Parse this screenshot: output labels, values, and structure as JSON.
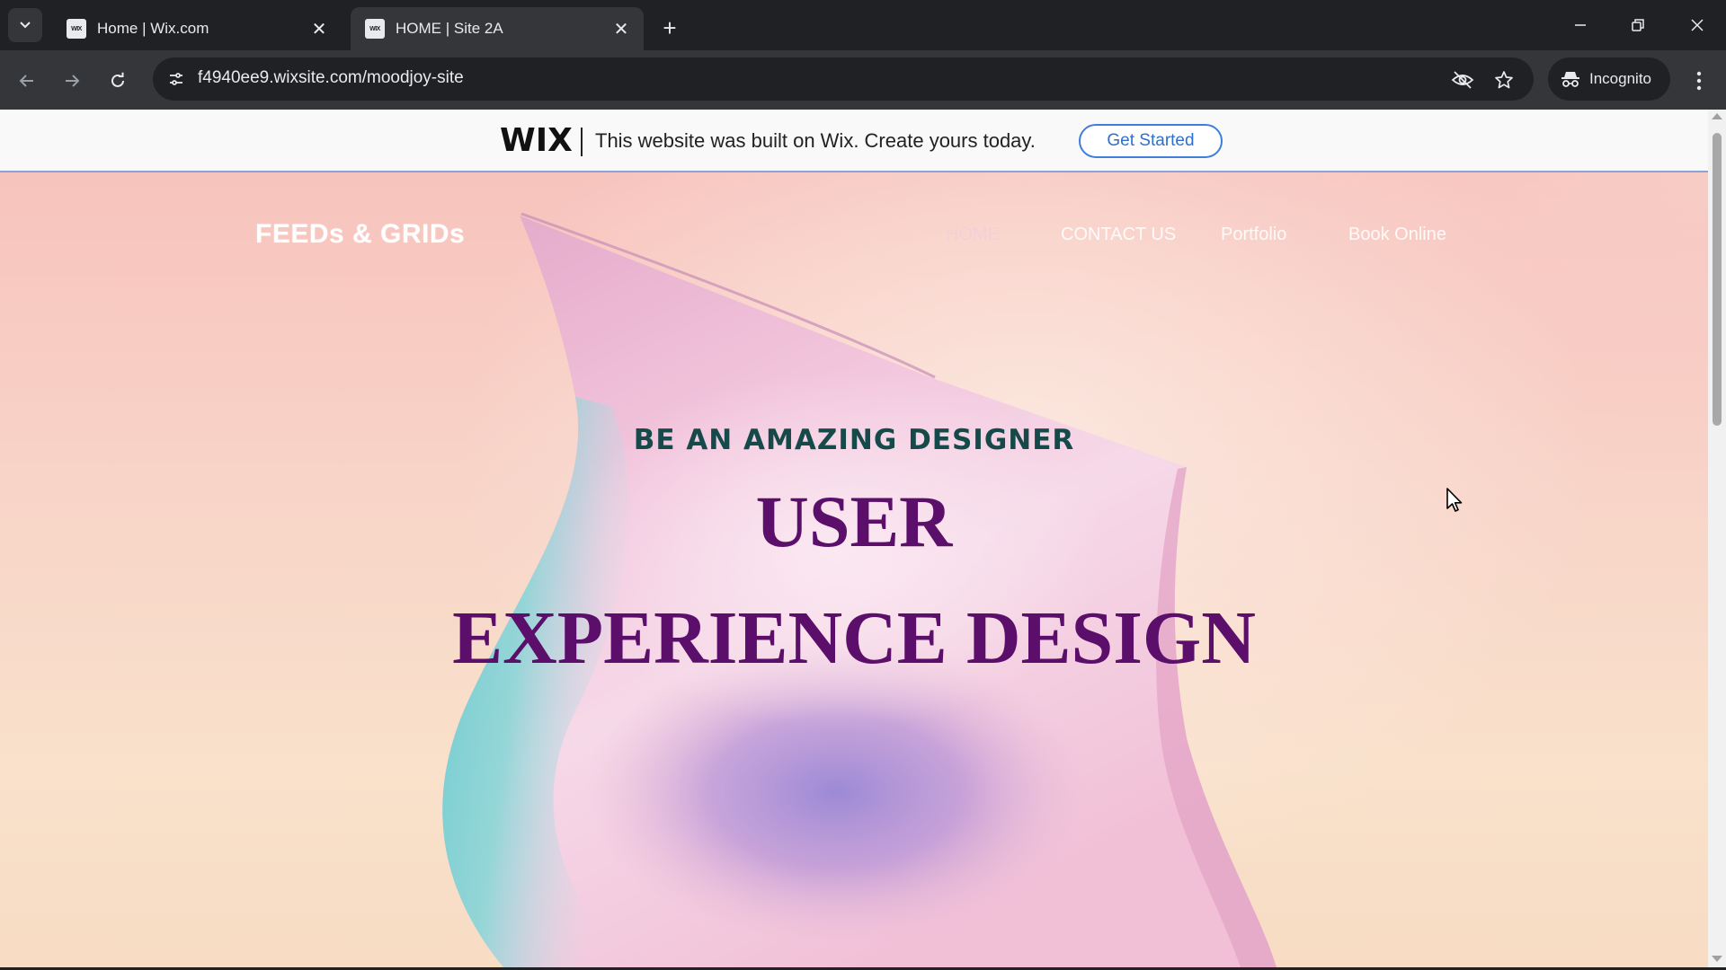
{
  "browser": {
    "tabs": [
      {
        "title": "Home | Wix.com",
        "favicon": "WIX",
        "active": false
      },
      {
        "title": "HOME | Site 2A",
        "favicon": "WIX",
        "active": true
      }
    ],
    "url": "f4940ee9.wixsite.com/moodjoy-site",
    "incognito_label": "Incognito",
    "icons": [
      "tab-search-icon",
      "new-tab-icon",
      "minimize-icon",
      "restore-icon",
      "window-close-icon",
      "back-arrow-icon",
      "forward-arrow-icon",
      "reload-icon",
      "site-settings-icon",
      "eye-off-icon",
      "bookmark-star-icon",
      "incognito-icon",
      "more-vertical-icon"
    ]
  },
  "wix_banner": {
    "logo": "WIX",
    "message": "This website was built on Wix. Create yours today.",
    "cta_label": "Get Started",
    "cta_color": "#3e7fd9"
  },
  "site": {
    "logo": "FEEDs & GRIDs",
    "nav": [
      "HOME",
      "CONTACT US",
      "Portfolio",
      "Book Online"
    ],
    "hero": {
      "kicker": "BE AN AMAZING DESIGNER",
      "title_line1": "USER",
      "title_line2": "EXPERIENCE DESIGN"
    },
    "colors": {
      "kicker": "#164a4a",
      "title": "#5b0f6a",
      "background_top": "#f7c3bd",
      "background_bottom": "#f8dcc4"
    }
  }
}
